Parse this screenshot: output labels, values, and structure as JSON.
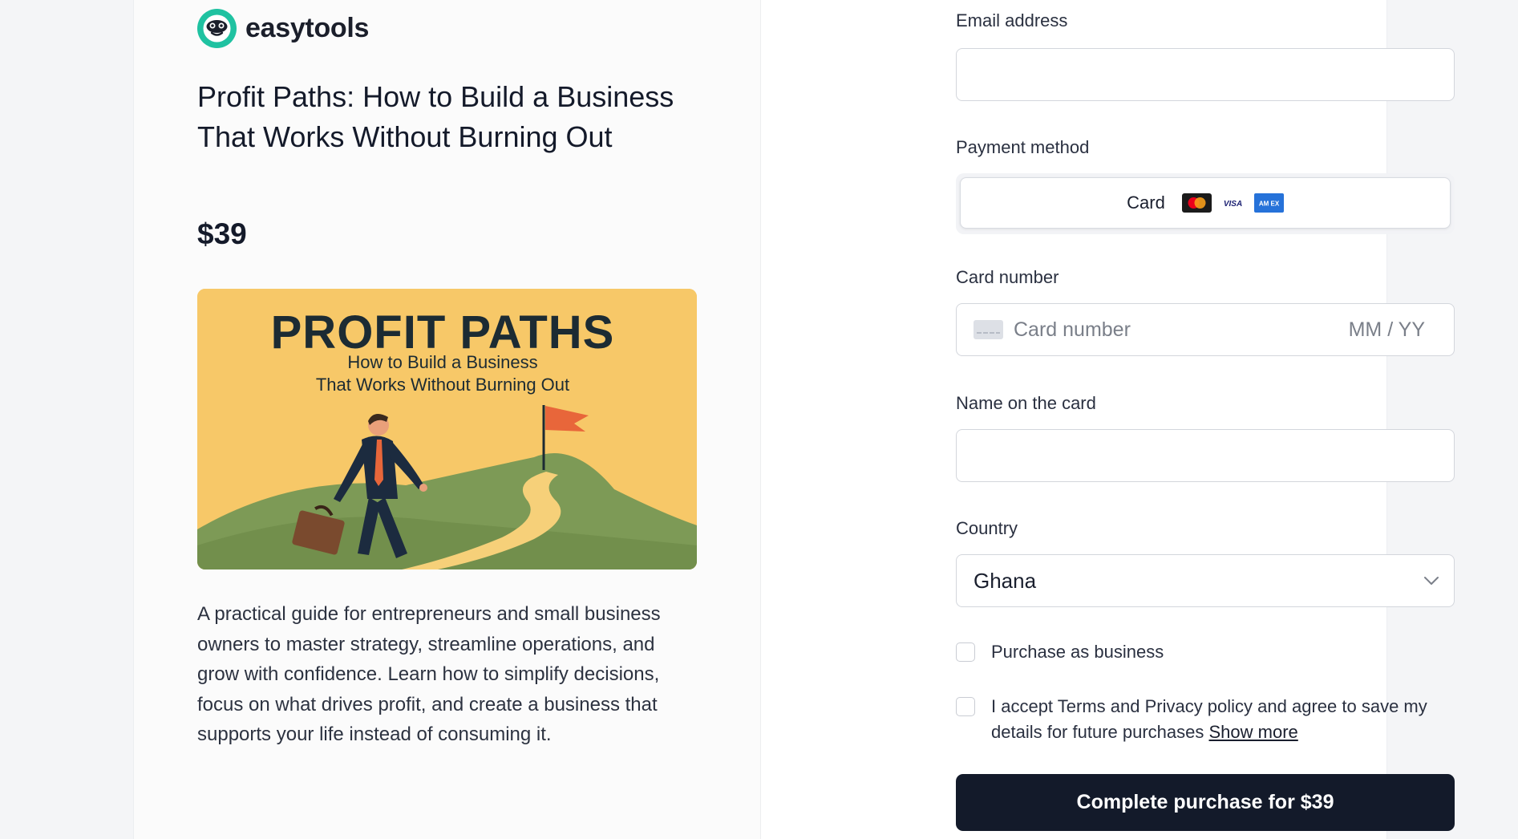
{
  "brand": {
    "name": "easytools"
  },
  "product": {
    "title": "Profit Paths: How to Build a Business That Works Without Burning Out",
    "price": "$39",
    "description": "A practical guide for entrepreneurs and small business owners to master strategy, streamline operations, and grow with confidence. Learn how to simplify decisions, focus on what drives profit, and create a business that supports your life instead of consuming it.",
    "cover": {
      "headline": "PROFIT PATHS",
      "subtitle_line1": "How to Build a Business",
      "subtitle_line2": "That Works Without Burning Out"
    }
  },
  "form": {
    "email": {
      "label": "Email address",
      "value": ""
    },
    "payment_method": {
      "label": "Payment method",
      "selected": "Card",
      "brands": [
        "mastercard-icon",
        "visa-icon",
        "amex-icon"
      ],
      "visa_text": "VISA",
      "amex_text": "AM EX"
    },
    "card_number": {
      "label": "Card number",
      "placeholder": "Card number",
      "expiry_placeholder": "MM / YY"
    },
    "name_on_card": {
      "label": "Name on the card",
      "value": ""
    },
    "country": {
      "label": "Country",
      "value": "Ghana"
    },
    "purchase_as_business": {
      "label": "Purchase as business",
      "checked": false
    },
    "terms": {
      "label": "I accept Terms and Privacy policy and agree to save my details for future purchases",
      "link": "Show more",
      "checked": false
    },
    "submit_label": "Complete purchase for $39"
  },
  "colors": {
    "primary_button": "#131a2a",
    "brand_teal": "#1fc2a1",
    "cover_background": "#f7c868",
    "cover_hill": "#7d9a56",
    "flag": "#e8663a"
  }
}
